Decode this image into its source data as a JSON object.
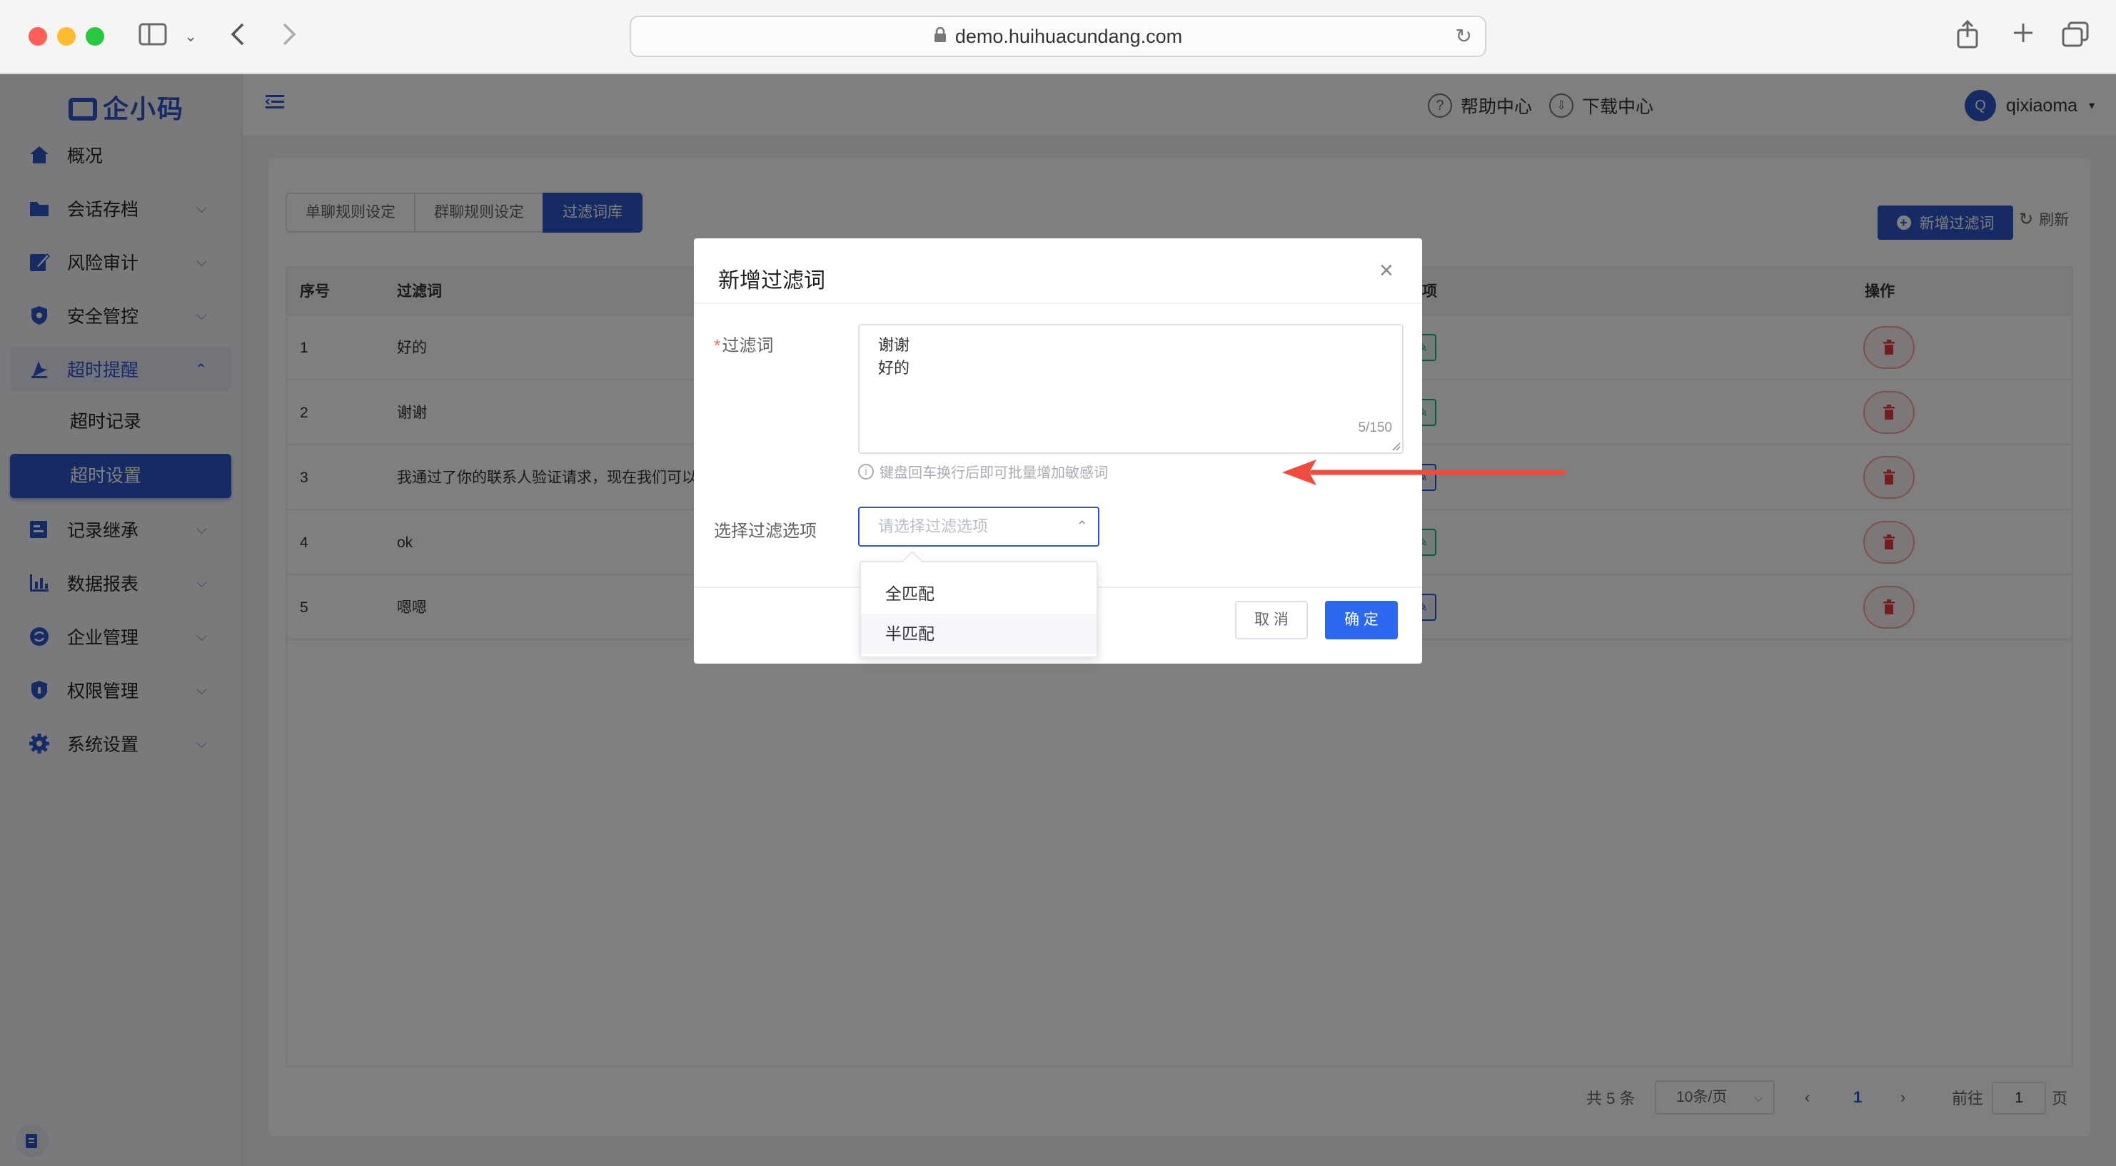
{
  "browser": {
    "url": "demo.huihuacundang.com"
  },
  "app": {
    "logo_text": "企小码",
    "header": {
      "help": "帮助中心",
      "download": "下载中心",
      "avatar_letter": "Q",
      "username": "qixiaoma"
    },
    "sidebar": {
      "items": [
        {
          "label": "概况",
          "icon": "home-icon"
        },
        {
          "label": "会话存档",
          "icon": "folder-icon"
        },
        {
          "label": "风险审计",
          "icon": "edit-icon"
        },
        {
          "label": "安全管控",
          "icon": "shield-icon"
        },
        {
          "label": "超时提醒",
          "icon": "alarm-icon"
        },
        {
          "label": "记录继承",
          "icon": "transfer-icon"
        },
        {
          "label": "数据报表",
          "icon": "chart-icon"
        },
        {
          "label": "企业管理",
          "icon": "sync-icon"
        },
        {
          "label": "权限管理",
          "icon": "lock-shield-icon"
        },
        {
          "label": "系统设置",
          "icon": "gear-icon"
        }
      ],
      "sub_items": [
        {
          "label": "超时记录"
        },
        {
          "label": "超时设置"
        }
      ]
    }
  },
  "main": {
    "tabs": [
      "单聊规则设定",
      "群聊规则设定",
      "过滤词库"
    ],
    "add_button": "新增过滤词",
    "refresh_button": "刷新",
    "table": {
      "headers": [
        "序号",
        "过滤词",
        "项",
        "操作"
      ],
      "rows": [
        {
          "index": "1",
          "word": "好的"
        },
        {
          "index": "2",
          "word": "谢谢"
        },
        {
          "index": "3",
          "word": "我通过了你的联系人验证请求，现在我们可以开"
        },
        {
          "index": "4",
          "word": "ok"
        },
        {
          "index": "5",
          "word": "嗯嗯"
        }
      ]
    },
    "pagination": {
      "total": "共 5 条",
      "page_size": "10条/页",
      "current_page": "1",
      "goto_label": "前往",
      "goto_value": "1",
      "page_suffix": "页"
    }
  },
  "modal": {
    "title": "新增过滤词",
    "word_label": "过滤词",
    "word_lines": [
      "谢谢",
      "好的"
    ],
    "char_count": "5/150",
    "hint": "键盘回车换行后即可批量增加敏感词",
    "option_label": "选择过滤选项",
    "option_placeholder": "请选择过滤选项",
    "options": [
      "全匹配",
      "半匹配"
    ],
    "cancel": "取 消",
    "confirm": "确 定"
  },
  "colors": {
    "brand": "#2d57c8",
    "annotation_arrow": "#ef4b3f",
    "danger": "#f56c6c",
    "success": "#20b07a"
  }
}
